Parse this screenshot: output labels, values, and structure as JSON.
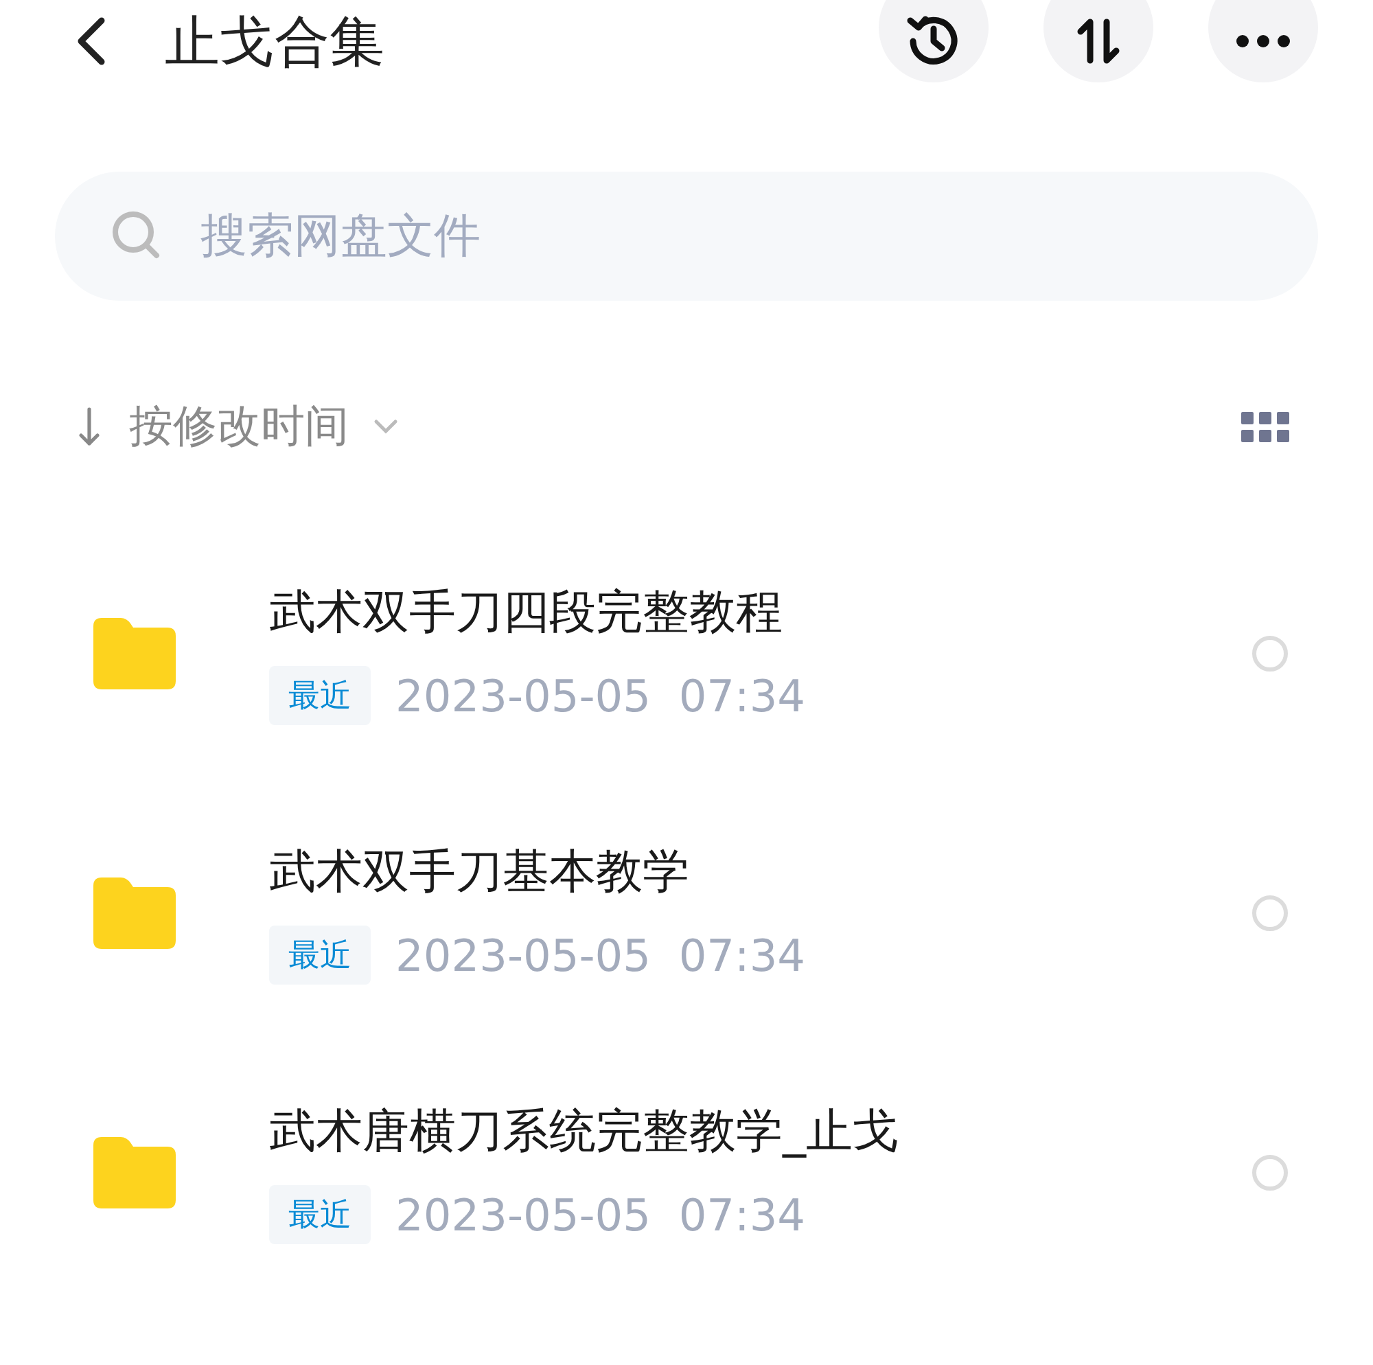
{
  "header": {
    "title": "止戈合集"
  },
  "search": {
    "placeholder": "搜索网盘文件"
  },
  "sort": {
    "label": "按修改时间"
  },
  "files": [
    {
      "name": "武术双手刀四段完整教程",
      "tag": "最近",
      "date": "2023-05-05  07:34",
      "selected": false
    },
    {
      "name": "武术双手刀基本教学",
      "tag": "最近",
      "date": "2023-05-05  07:34",
      "selected": false
    },
    {
      "name": "武术唐横刀系统完整教学_止戈",
      "tag": "最近",
      "date": "2023-05-05  07:34",
      "selected": false
    }
  ]
}
